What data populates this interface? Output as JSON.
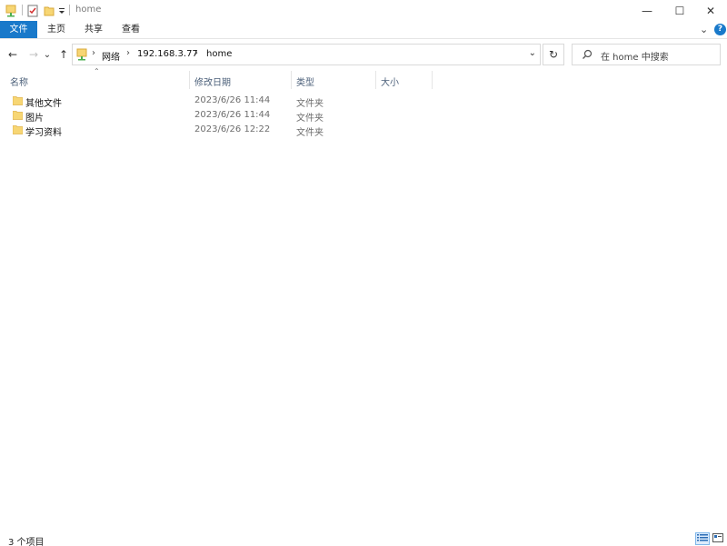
{
  "window": {
    "title": "home",
    "minimize_glyph": "—",
    "maximize_glyph": "☐",
    "close_glyph": "✕"
  },
  "ribbon": {
    "tabs": [
      "文件",
      "主页",
      "共享",
      "查看"
    ],
    "expand_glyph": "⌄",
    "help_glyph": "?"
  },
  "nav": {
    "back_glyph": "←",
    "forward_glyph": "→",
    "recent_glyph": "⌄",
    "up_glyph": "↑",
    "breadcrumb": [
      "网络",
      "192.168.3.77",
      "home"
    ],
    "crumb_sep_glyph": "›",
    "dropdown_glyph": "⌄",
    "refresh_glyph": "↻"
  },
  "search": {
    "placeholder": "在 home 中搜索"
  },
  "columns": {
    "name": "名称",
    "modified": "修改日期",
    "type": "类型",
    "size": "大小",
    "sort_glyph": "⌃"
  },
  "files": [
    {
      "name": "其他文件",
      "modified": "2023/6/26 11:44",
      "type": "文件夹"
    },
    {
      "name": "图片",
      "modified": "2023/6/26 11:44",
      "type": "文件夹"
    },
    {
      "name": "学习资料",
      "modified": "2023/6/26 12:22",
      "type": "文件夹"
    }
  ],
  "status": {
    "item_count": "3 个项目"
  },
  "colors": {
    "accent": "#1979ca",
    "folder": "#f7d674",
    "folder_dark": "#e8b84a"
  }
}
